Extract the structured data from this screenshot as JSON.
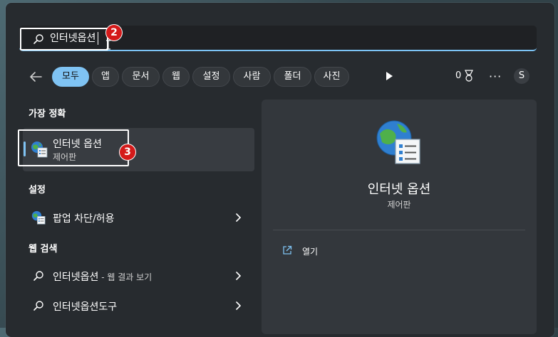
{
  "search": {
    "query": "인터넷옵션",
    "step_badge": "2"
  },
  "filters": {
    "chips": [
      {
        "label": "모두",
        "active": true
      },
      {
        "label": "앱"
      },
      {
        "label": "문서"
      },
      {
        "label": "웹"
      },
      {
        "label": "설정"
      },
      {
        "label": "사람"
      },
      {
        "label": "폴더"
      },
      {
        "label": "사진"
      }
    ],
    "points": "0",
    "more": "···",
    "avatar_initial": "S"
  },
  "best_match": {
    "section_title": "가장 정확",
    "title": "인터넷 옵션",
    "subtitle": "제어판",
    "step_badge": "3"
  },
  "settings": {
    "section_title": "설정",
    "items": [
      {
        "label": "팝업 차단/허용"
      }
    ]
  },
  "web_search": {
    "section_title": "웹 검색",
    "items": [
      {
        "label": "인터넷옵션",
        "suffix": " - 웹 결과 보기"
      },
      {
        "label": "인터넷옵션도구",
        "suffix": ""
      }
    ]
  },
  "detail": {
    "title": "인터넷 옵션",
    "subtitle": "제어판",
    "actions": [
      {
        "label": "열기",
        "icon": "open-external-icon"
      }
    ]
  },
  "colors": {
    "accent": "#7fc3f3",
    "badge": "#d41a1a",
    "panel": "#272b2f"
  }
}
